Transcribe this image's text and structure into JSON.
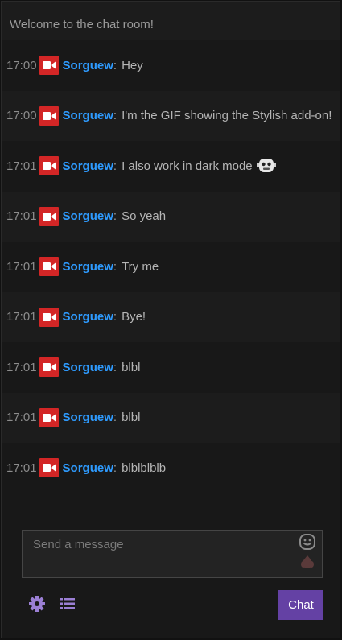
{
  "welcome_text": "Welcome to the chat room!",
  "messages": [
    {
      "time": "17:00",
      "user": "Sorguew",
      "text": "Hey",
      "has_emoji": false
    },
    {
      "time": "17:00",
      "user": "Sorguew",
      "text": "I'm the GIF showing the Stylish add-on!",
      "has_emoji": false
    },
    {
      "time": "17:01",
      "user": "Sorguew",
      "text": "I also work in dark mode",
      "has_emoji": true
    },
    {
      "time": "17:01",
      "user": "Sorguew",
      "text": "So yeah",
      "has_emoji": false
    },
    {
      "time": "17:01",
      "user": "Sorguew",
      "text": "Try me",
      "has_emoji": false
    },
    {
      "time": "17:01",
      "user": "Sorguew",
      "text": "Bye!",
      "has_emoji": false
    },
    {
      "time": "17:01",
      "user": "Sorguew",
      "text": "blbl",
      "has_emoji": false
    },
    {
      "time": "17:01",
      "user": "Sorguew",
      "text": "blbl",
      "has_emoji": false
    },
    {
      "time": "17:01",
      "user": "Sorguew",
      "text": "blblblblb",
      "has_emoji": false
    }
  ],
  "separator": ":",
  "input": {
    "placeholder": "Send a message",
    "value": ""
  },
  "chat_button_label": "Chat",
  "icons": {
    "badge": "camera-icon",
    "emoji": "robot-emoji-icon",
    "smiley": "smiley-icon",
    "drop": "bits-icon",
    "settings": "gear-icon",
    "list": "list-icon"
  },
  "colors": {
    "username": "#2e9bff",
    "badge": "#d32626",
    "button": "#6441a4",
    "background": "#181818",
    "settings_icon": "#9b7fd4"
  }
}
